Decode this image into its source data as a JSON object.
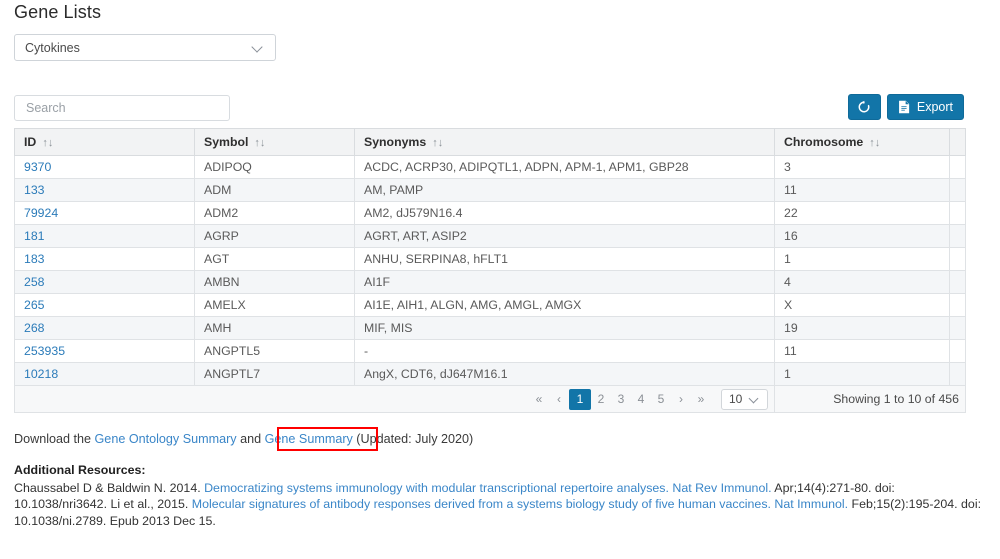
{
  "page_title": "Gene Lists",
  "gene_list_select": {
    "value": "Cytokines",
    "icon": "chevron-down-icon"
  },
  "search": {
    "placeholder": "Search",
    "value": ""
  },
  "toolbar": {
    "reset_icon": "refresh-icon",
    "export_icon": "document-icon",
    "export_label": "Export"
  },
  "table": {
    "columns": [
      {
        "label": "ID",
        "sorter": "↑↓"
      },
      {
        "label": "Symbol",
        "sorter": "↑↓"
      },
      {
        "label": "Synonyms",
        "sorter": "↑↓"
      },
      {
        "label": "Chromosome",
        "sorter": "↑↓"
      }
    ],
    "rows": [
      {
        "id": "9370",
        "symbol": "ADIPOQ",
        "synonyms": "ACDC, ACRP30, ADIPQTL1, ADPN, APM-1, APM1, GBP28",
        "chromosome": "3"
      },
      {
        "id": "133",
        "symbol": "ADM",
        "synonyms": "AM, PAMP",
        "chromosome": "11"
      },
      {
        "id": "79924",
        "symbol": "ADM2",
        "synonyms": "AM2, dJ579N16.4",
        "chromosome": "22"
      },
      {
        "id": "181",
        "symbol": "AGRP",
        "synonyms": "AGRT, ART, ASIP2",
        "chromosome": "16"
      },
      {
        "id": "183",
        "symbol": "AGT",
        "synonyms": "ANHU, SERPINA8, hFLT1",
        "chromosome": "1"
      },
      {
        "id": "258",
        "symbol": "AMBN",
        "synonyms": "AI1F",
        "chromosome": "4"
      },
      {
        "id": "265",
        "symbol": "AMELX",
        "synonyms": "AI1E, AIH1, ALGN, AMG, AMGL, AMGX",
        "chromosome": "X"
      },
      {
        "id": "268",
        "symbol": "AMH",
        "synonyms": "MIF, MIS",
        "chromosome": "19"
      },
      {
        "id": "253935",
        "symbol": "ANGPTL5",
        "synonyms": "-",
        "chromosome": "11"
      },
      {
        "id": "10218",
        "symbol": "ANGPTL7",
        "synonyms": "AngX, CDT6, dJ647M16.1",
        "chromosome": "1"
      }
    ]
  },
  "pagination": {
    "first": "«",
    "prev": "‹",
    "pages": [
      "1",
      "2",
      "3",
      "4",
      "5"
    ],
    "active_page": "1",
    "next": "›",
    "last": "»",
    "page_size": "10",
    "page_size_icon": "chevron-down-icon",
    "showing": "Showing 1 to 10 of 456"
  },
  "download": {
    "prefix": "Download the ",
    "link1": "Gene Ontology Summary",
    "middle": " and ",
    "link2": "Gene Summary",
    "suffix": " (Updated: July 2020)"
  },
  "annotation": {
    "type": "red-highlight-box",
    "color": "#ff0000",
    "target": "Gene Summary"
  },
  "additional_resources": {
    "heading": "Additional Resources:",
    "ref1_pre": "Chaussabel D & Baldwin N. 2014. ",
    "ref1_link": "Democratizing systems immunology with modular transcriptional repertoire analyses. Nat Rev Immunol.",
    "ref1_post": " Apr;14(4):271-80. doi: 10.1038/nri3642. ",
    "ref2_pre": "Li et al., 2015. ",
    "ref2_link": "Molecular signatures of antibody responses derived from a systems biology study of five human vaccines. Nat Immunol.",
    "ref2_post": " Feb;15(2):195-204. doi: 10.1038/ni.2789. Epub 2013 Dec 15."
  },
  "colors": {
    "accent": "#1275a8",
    "link": "#3a86c8",
    "id_link": "#2b7bb9",
    "annotation": "#ff0000"
  }
}
